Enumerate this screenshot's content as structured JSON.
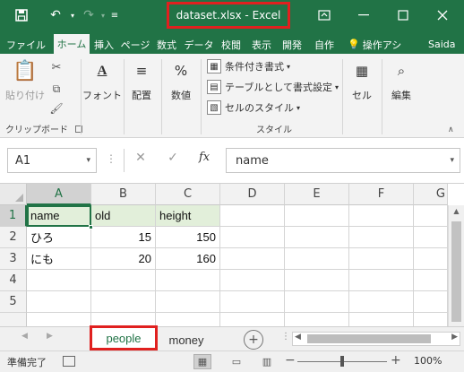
{
  "app": {
    "window_title": "dataset.xlsx - Excel",
    "accent_color": "#217346",
    "highlight_color": "#e0201f"
  },
  "ribbon_tabs": [
    {
      "label": "ファイル",
      "active": false
    },
    {
      "label": "ホーム",
      "active": true
    },
    {
      "label": "挿入",
      "active": false
    },
    {
      "label": "ページ",
      "active": false
    },
    {
      "label": "数式",
      "active": false
    },
    {
      "label": "データ",
      "active": false
    },
    {
      "label": "校閲",
      "active": false
    },
    {
      "label": "表示",
      "active": false
    },
    {
      "label": "開発",
      "active": false
    },
    {
      "label": "自作",
      "active": false
    }
  ],
  "search_label": "操作アシ",
  "user_name": "Saida",
  "ribbon": {
    "paste_label": "貼り付け",
    "clipboard_group": "クリップボード",
    "font_label": "フォント",
    "align_label": "配置",
    "number_label": "数値",
    "cond_format": "条件付き書式",
    "table_format": "テーブルとして書式設定",
    "cell_styles": "セルのスタイル",
    "styles_group": "スタイル",
    "cells_label": "セル",
    "edit_label": "編集"
  },
  "formula_bar": {
    "name_box": "A1",
    "content": "name",
    "fx": "fx"
  },
  "grid": {
    "columns": [
      "A",
      "B",
      "C",
      "D",
      "E",
      "F",
      "G"
    ],
    "rows": [
      "1",
      "2",
      "3",
      "4",
      "5"
    ],
    "cells": [
      [
        "name",
        "old",
        "height"
      ],
      [
        "ひろ",
        "15",
        "150"
      ],
      [
        "にも",
        "20",
        "160"
      ]
    ],
    "selected_cell": "A1"
  },
  "sheets": {
    "active": "people",
    "others": [
      "money"
    ]
  },
  "status": {
    "ready_text": "準備完了",
    "zoom": "100%"
  }
}
